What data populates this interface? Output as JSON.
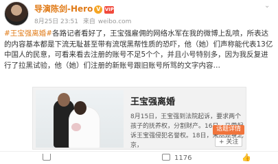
{
  "post": {
    "author": "导演陈剑-Hero",
    "verified_mark": "V",
    "vip_mark": "VIP",
    "time": "8月25日 23:51",
    "source_prefix": "来自",
    "source": "weibo.com",
    "hashtag": "#王宝强离婚#",
    "body": "各路记者看好了，王宝强雇佣的网络水军在我的微博上乱喷，所表达的内容基本都是下流无耻甚至带有流氓黑帮性质的恐吓，他（她）们声称能代表13亿中国人的民意，可看来看去注册的账号不足5个个，并且小号特别多，因为我反复进行了拉黑试验，他（她）们注册的新账号跟旧账号所骂的文字内容…"
  },
  "card": {
    "title": "王宝强离婚",
    "description": "8月15日，王宝强到法院起诉，要求两个孩子的抚养权，分割财产。16日，马蓉起诉王宝强侵犯名誉权。18日，宋喆现身北京，",
    "topic_button": "话题详情",
    "follow_button": "+ 关注"
  },
  "actions": {
    "share": "",
    "comment": "1176",
    "like": ""
  },
  "colors": {
    "author": "#e07a16",
    "hashtag": "#e07a16",
    "topic_button_bg": "#f0743c"
  },
  "icons": [
    "avatar",
    "verified-badge-icon",
    "vip-icon",
    "chevron-down-icon",
    "share-icon",
    "comment-icon",
    "like-icon"
  ]
}
